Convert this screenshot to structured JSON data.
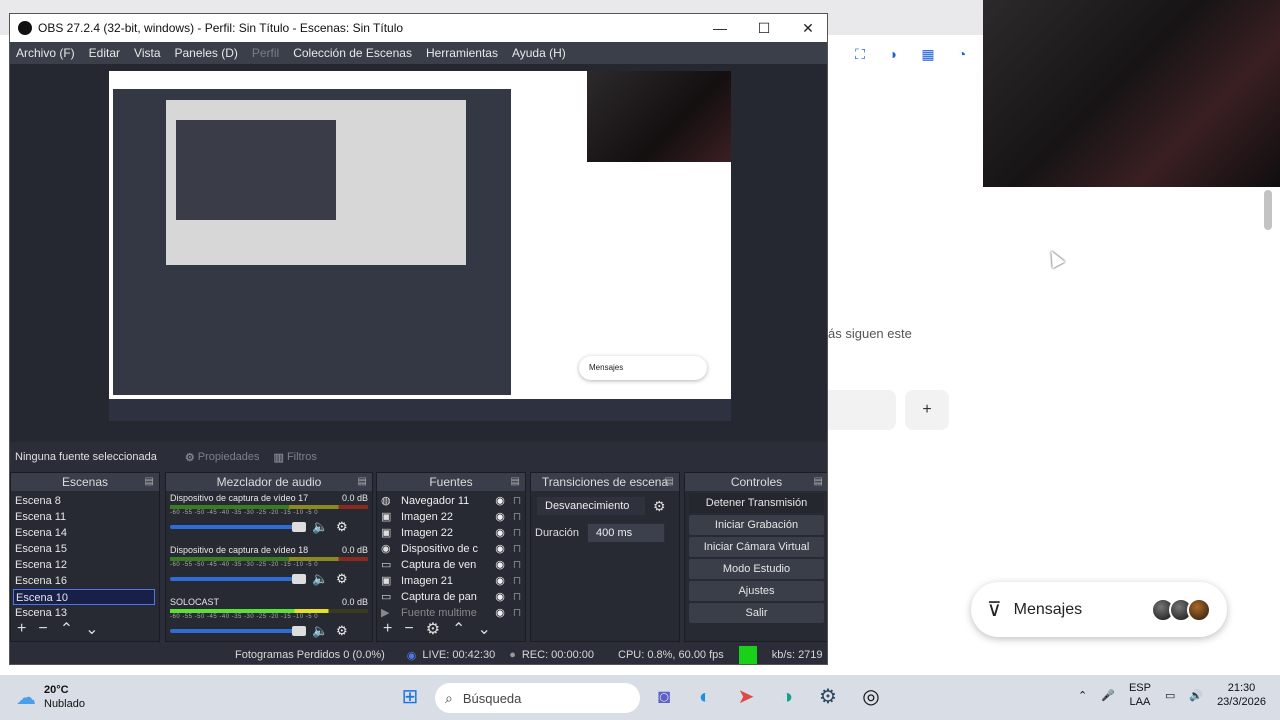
{
  "obs": {
    "title": "OBS 27.2.4 (32-bit, windows) - Perfil: Sin Título - Escenas: Sin Título",
    "menu": [
      "Archivo (F)",
      "Editar",
      "Vista",
      "Paneles (D)",
      "Perfil",
      "Colección de Escenas",
      "Herramientas",
      "Ayuda (H)"
    ],
    "menu_disabled_index": 4,
    "no_source": "Ninguna fuente seleccionada",
    "properties": "Propiedades",
    "filters": "Filtros",
    "docks": {
      "scenes": "Escenas",
      "mixer": "Mezclador de audio",
      "sources": "Fuentes",
      "transitions": "Transiciones de escena",
      "controls": "Controles"
    },
    "scenes": [
      "Escena 8",
      "Escena 11",
      "Escena 14",
      "Escena 15",
      "Escena 12",
      "Escena 16",
      "Escena 10",
      "Escena 13"
    ],
    "selected_scene_index": 6,
    "mixer": [
      {
        "name": "Dispositivo de captura de vídeo 17",
        "db": "0.0 dB"
      },
      {
        "name": "Dispositivo de captura de vídeo 18",
        "db": "0.0 dB"
      },
      {
        "name": "SOLOCAST",
        "db": "0.0 dB"
      }
    ],
    "meter_ticks": "-60 -55 -50 -45 -40 -35 -30 -25 -20 -15 -10 -5 0",
    "sources": [
      {
        "name": "Navegador 11",
        "icon": "globe-icon",
        "glyph": "◍"
      },
      {
        "name": "Imagen 22",
        "icon": "image-icon",
        "glyph": "▣"
      },
      {
        "name": "Imagen 22",
        "icon": "image-icon",
        "glyph": "▣"
      },
      {
        "name": "Dispositivo de c",
        "icon": "camera-icon",
        "glyph": "◉"
      },
      {
        "name": "Captura de ven",
        "icon": "window-icon",
        "glyph": "▭"
      },
      {
        "name": "Imagen 21",
        "icon": "image-icon",
        "glyph": "▣"
      },
      {
        "name": "Captura de pan",
        "icon": "monitor-icon",
        "glyph": "▭"
      },
      {
        "name": "Fuente multime",
        "icon": "play-icon",
        "glyph": "▶"
      }
    ],
    "transition": {
      "type": "Desvanecimiento",
      "duration_label": "Duración",
      "duration": "400 ms"
    },
    "controls": [
      "Detener Transmisión",
      "Iniciar Grabación",
      "Iniciar Cámara Virtual",
      "Modo Estudio",
      "Ajustes",
      "Salir"
    ],
    "status": {
      "dropped": "Fotogramas Perdidos 0 (0.0%)",
      "live": "LIVE: 00:42:30",
      "rec": "REC: 00:00:00",
      "cpu": "CPU: 0.8%, 60.00 fps",
      "kbps": "kb/s: 2719"
    }
  },
  "background": {
    "follow_text": "ás siguen este",
    "messages_label": "Mensajes"
  },
  "taskbar": {
    "temp": "20°C",
    "weather": "Nublado",
    "search_placeholder": "Búsqueda",
    "lang1": "ESP",
    "lang2": "LAA",
    "time": "21:30",
    "date": "23/3/2026"
  },
  "colors": {
    "obs_bg": "#2b2e38",
    "selection": "#4b78e6",
    "live_green": "#19d119"
  }
}
